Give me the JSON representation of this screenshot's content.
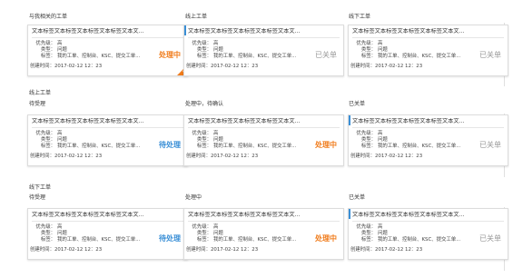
{
  "labels": {
    "my_tickets": "与我相关的工单",
    "online_tickets": "线上工单",
    "offline_tickets": "线下工单",
    "online_tickets_2": "线上工单",
    "pending_accept_1": "待受理",
    "processing_pending_confirm": "处理中，待确认",
    "closed_1": "已关单",
    "offline_tickets_2": "线下工单",
    "pending_accept_2": "待受理",
    "processing": "处理中",
    "closed_2": "已关单"
  },
  "field_labels": {
    "priority": "优先级：",
    "type": "类型：",
    "tags": "标签：",
    "created": "创建时间："
  },
  "cards": [
    {
      "title": "文本标签文本标签文本标签文本标签文本文...",
      "priority": "高",
      "type": "问题",
      "tags": "我的工单、控制台、KSC、提交工单...",
      "created": "2017-02-12 12：23",
      "status": "处理中",
      "status_color": "#f07b1a"
    },
    {
      "title": "文本标签文本标签文本标签文本标签文本文...",
      "priority": "高",
      "type": "问题",
      "tags": "我的工单、控制台、KSC、提交工单...",
      "created": "2017-02-12 12：23",
      "status": "已关单",
      "status_color": "#999999"
    },
    {
      "title": "文本标签文本标签文本标签文本标签文本文...",
      "priority": "高",
      "type": "问题",
      "tags": "我的工单、控制台、KSC、提交工单...",
      "created": "2017-02-12 12：23",
      "status": "已关单",
      "status_color": "#999999"
    },
    {
      "title": "文本标签文本标签文本标签文本标签文本文...",
      "priority": "高",
      "type": "问题",
      "tags": "我的工单、控制台、KSC、提交工单...",
      "created": "2017-02-12 12：23",
      "status": "待处理",
      "status_color": "#3a8fd6"
    },
    {
      "title": "文本标签文本标签文本标签文本标签文本文...",
      "priority": "高",
      "type": "问题",
      "tags": "我的工单、控制台、KSC、提交工单...",
      "created": "2017-02-12 12：23",
      "status": "处理中",
      "status_color": "#f07b1a"
    },
    {
      "title": "文本标签文本标签文本标签文本标签文本文...",
      "priority": "高",
      "type": "问题",
      "tags": "我的工单、控制台、KSC、提交工单...",
      "created": "2017-02-12 12：23",
      "status": "已关单",
      "status_color": "#999999"
    },
    {
      "title": "文本标签文本标签文本标签文本标签文本文...",
      "priority": "高",
      "type": "问题",
      "tags": "我的工单、控制台、KSC、提交工单...",
      "created": "2017-02-12 12：23",
      "status": "待处理",
      "status_color": "#3a8fd6"
    },
    {
      "title": "文本标签文本标签文本标签文本标签文本文...",
      "priority": "高",
      "type": "问题",
      "tags": "我的工单、控制台、KSC、提交工单...",
      "created": "2017-02-12 12：23",
      "status": "处理中",
      "status_color": "#f07b1a"
    },
    {
      "title": "文本标签文本标签文本标签文本标签文本文...",
      "priority": "高",
      "type": "问题",
      "tags": "我的工单、控制台、KSC、提交工单...",
      "created": "2017-02-12 12：23",
      "status": "已关单",
      "status_color": "#999999"
    }
  ],
  "colors": {
    "accent_blue": "#3a8fd6",
    "accent_orange": "#f07b1a",
    "closed_gray": "#999999"
  },
  "icons": {
    "corner_badge": "edit-icon"
  }
}
